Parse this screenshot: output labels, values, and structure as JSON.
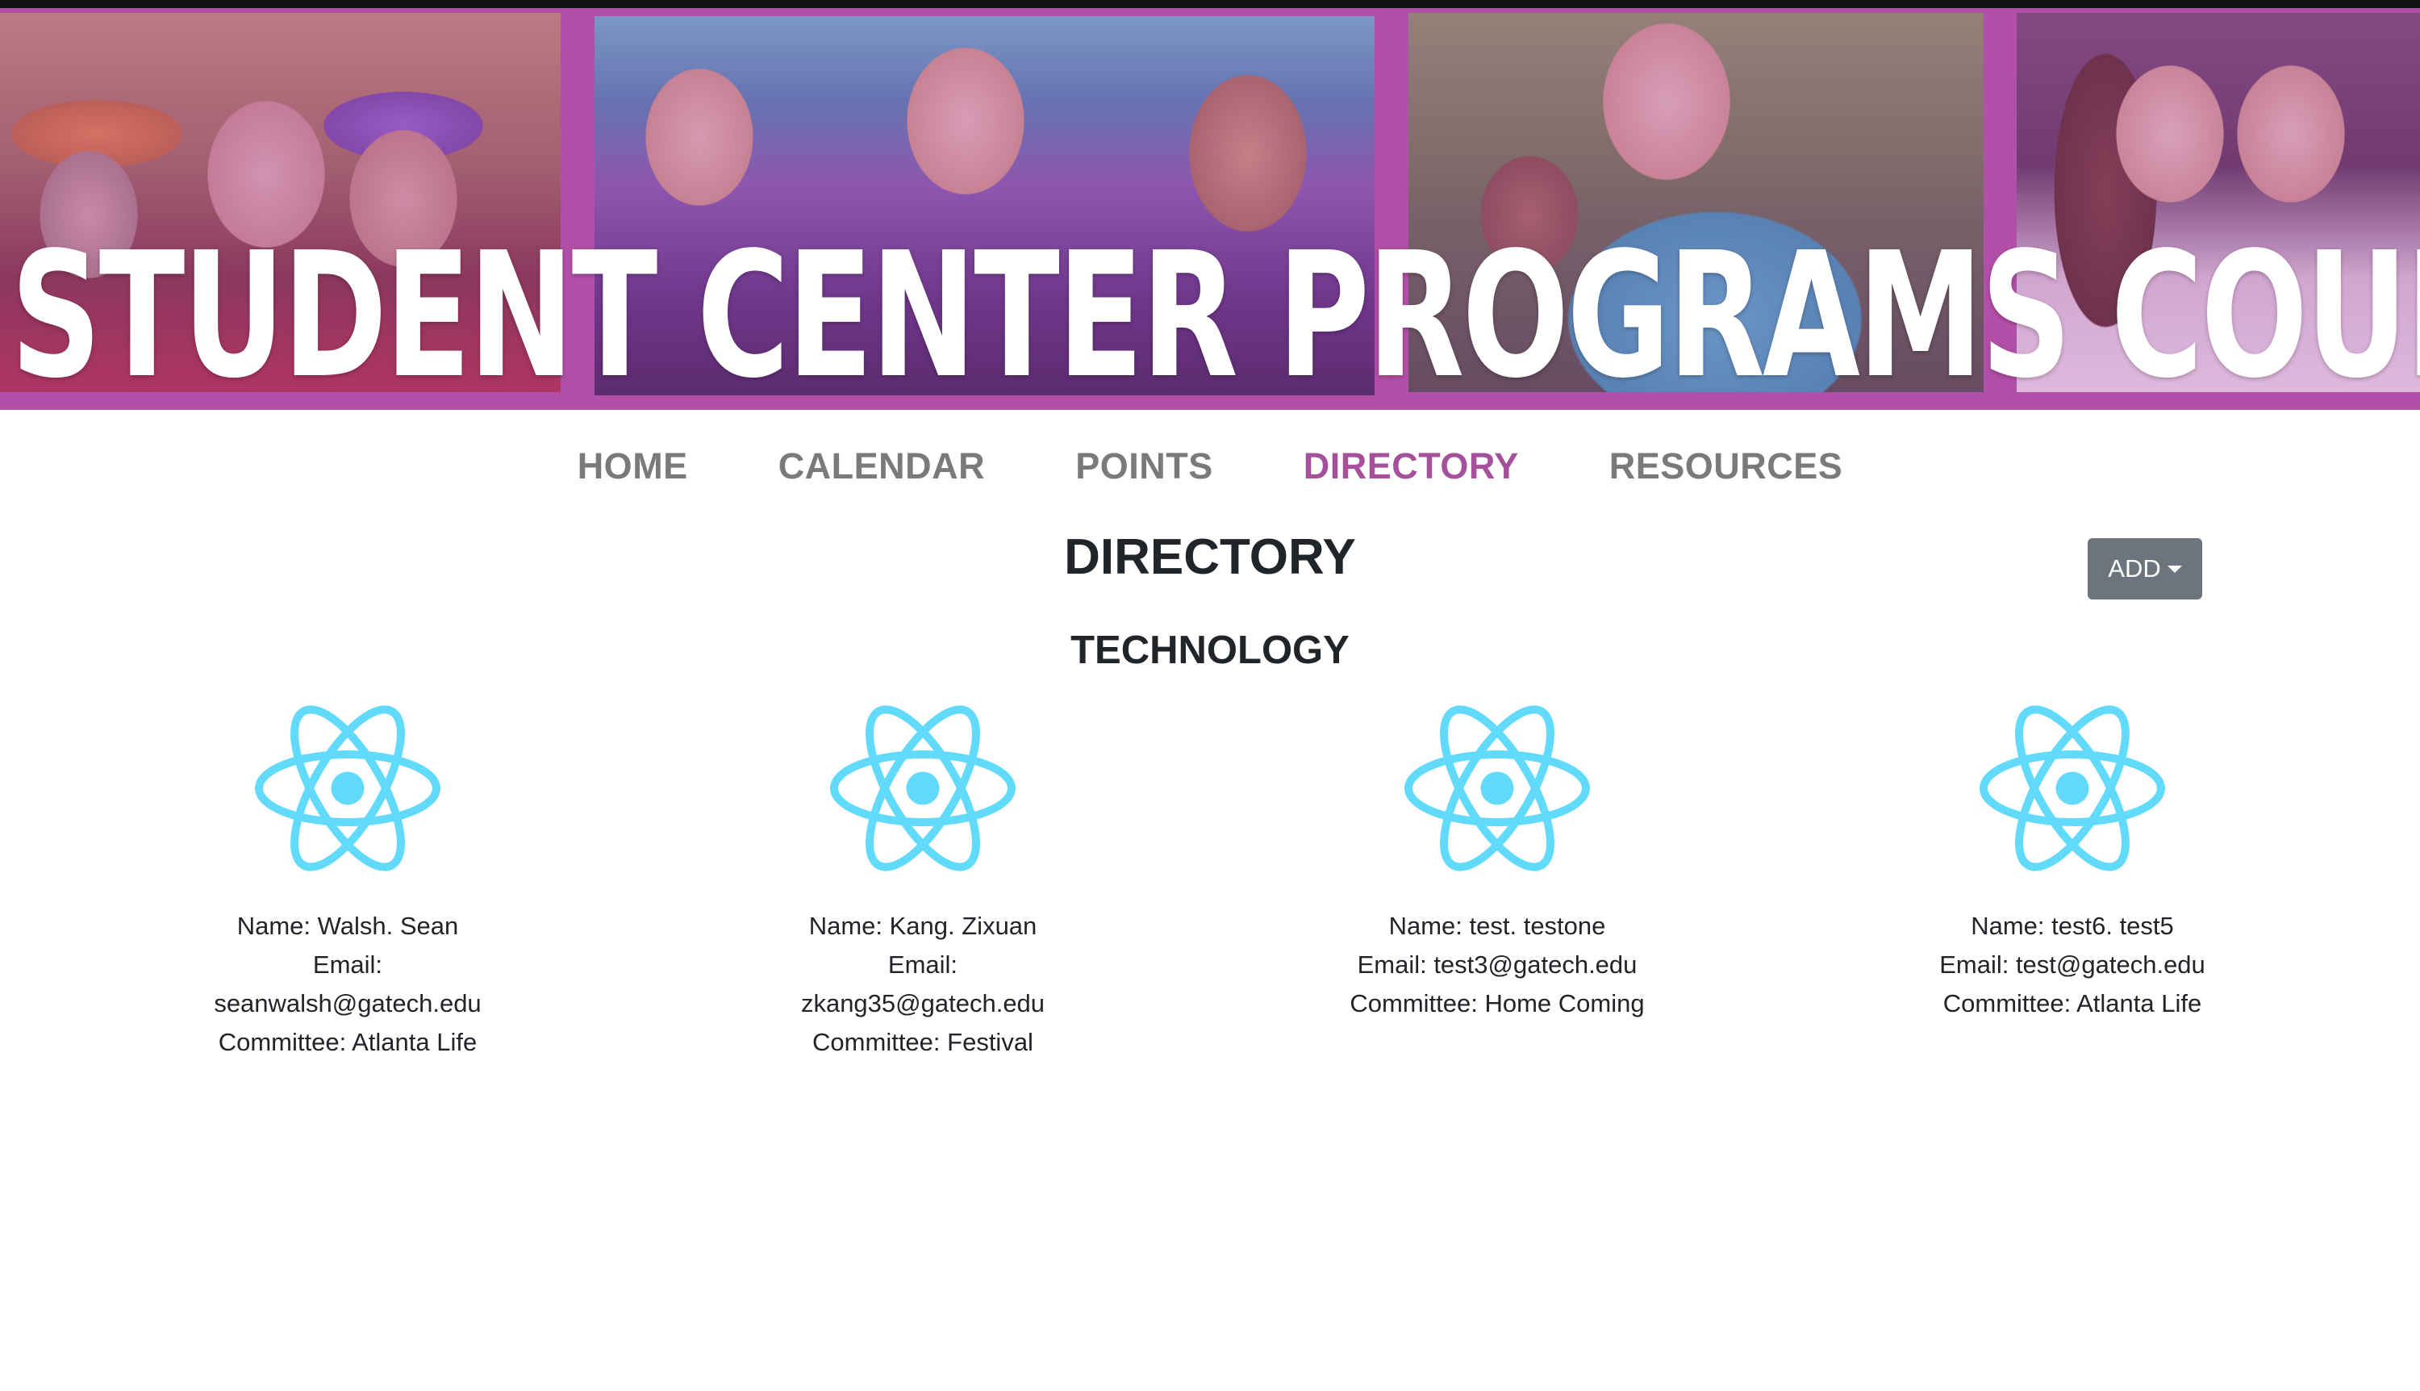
{
  "banner": {
    "title": "THE STUDENT CENTER PROGRAMS COUNCIL"
  },
  "nav": {
    "items": [
      {
        "label": "HOME"
      },
      {
        "label": "CALENDAR"
      },
      {
        "label": "POINTS"
      },
      {
        "label": "DIRECTORY",
        "active": true
      },
      {
        "label": "RESOURCES"
      }
    ]
  },
  "page": {
    "title": "DIRECTORY",
    "add_label": "ADD"
  },
  "section": {
    "title": "TECHNOLOGY"
  },
  "members": [
    {
      "name": "Name: Walsh. Sean",
      "email_label": "Email:",
      "email": "seanwalsh@gatech.edu",
      "committee": "Committee: Atlanta Life"
    },
    {
      "name": "Name: Kang. Zixuan",
      "email_label": "Email:",
      "email": "zkang35@gatech.edu",
      "committee": "Committee: Festival"
    },
    {
      "name": "Name: test. testone",
      "email_full": "Email: test3@gatech.edu",
      "committee": "Committee: Home Coming"
    },
    {
      "name": "Name: test6. test5",
      "email_full": "Email: test@gatech.edu",
      "committee": "Committee: Atlanta Life"
    }
  ],
  "colors": {
    "accent": "#a4509b",
    "icon": "#61dafb",
    "button": "#6c757d",
    "nav": "#7a7a7a"
  },
  "icons": {
    "member_avatar": "react-logo-icon",
    "add_caret": "caret-down-icon"
  }
}
